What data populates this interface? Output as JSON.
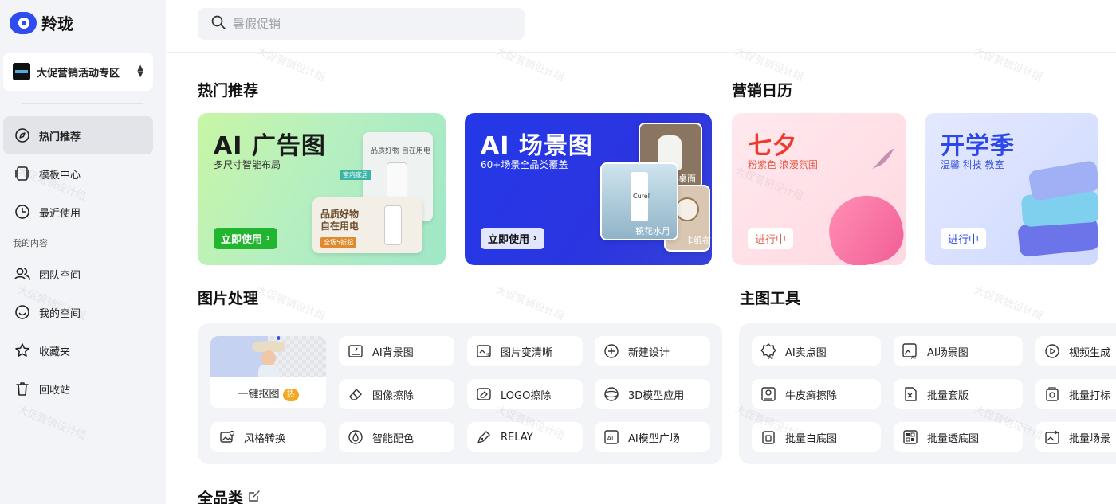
{
  "app": {
    "name": "羚珑"
  },
  "space": {
    "name": "大促营销活动专区"
  },
  "sidebar": {
    "items": [
      {
        "label": "热门推荐",
        "icon": "compass-icon"
      },
      {
        "label": "模板中心",
        "icon": "template-icon"
      },
      {
        "label": "最近使用",
        "icon": "clock-icon"
      }
    ],
    "my_section_label": "我的内容",
    "my_items": [
      {
        "label": "团队空间",
        "icon": "team-icon"
      },
      {
        "label": "我的空间",
        "icon": "smile-icon"
      },
      {
        "label": "收藏夹",
        "icon": "star-icon"
      },
      {
        "label": "回收站",
        "icon": "trash-icon"
      }
    ]
  },
  "search": {
    "placeholder": "暑假促销"
  },
  "sections": {
    "hot": "热门推荐",
    "calendar": "营销日历",
    "image_processing": "图片处理",
    "main_image_tools": "主图工具",
    "all_categories": "全品类"
  },
  "banners": {
    "ad": {
      "title": "AI 广告图",
      "subtitle": "多尺寸智能布局",
      "button": "立即使用",
      "card_text_1": "品质好物 自在用电",
      "card_tag": "室内家居",
      "card_text_2a": "品质好物",
      "card_text_2b": "自在用电",
      "card_ribbon": "全场5折起"
    },
    "scene": {
      "title": "AI 场景图",
      "subtitle": "60+场景全品类覆盖",
      "button": "立即使用",
      "tag_desk": "桌面",
      "tag_mirror": "镜花水月",
      "tag_card": "卡纸布",
      "brand": "Curél"
    },
    "qixi": {
      "title": "七夕",
      "subtitle": "粉紫色 浪漫氛围",
      "status": "进行中"
    },
    "school": {
      "title": "开学季",
      "subtitle": "温馨 科技 教室",
      "status": "进行中"
    }
  },
  "image_tools": {
    "cutout": {
      "label": "一键抠图",
      "badge": "热"
    },
    "items": [
      {
        "label": "AI背景图",
        "icon": "image-edit-icon"
      },
      {
        "label": "图片变清晰",
        "icon": "hd-image-icon"
      },
      {
        "label": "新建设计",
        "icon": "plus-circle-icon"
      },
      {
        "label": "图像擦除",
        "icon": "eraser-icon"
      },
      {
        "label": "LOGO擦除",
        "icon": "logo-erase-icon"
      },
      {
        "label": "3D模型应用",
        "icon": "cube-3d-icon"
      },
      {
        "label": "风格转换",
        "icon": "style-transfer-icon"
      },
      {
        "label": "智能配色",
        "icon": "palette-drop-icon"
      },
      {
        "label": "RELAY",
        "icon": "relay-pen-icon"
      },
      {
        "label": "AI模型广场",
        "icon": "ai-model-icon"
      }
    ]
  },
  "main_tools": {
    "items": [
      {
        "label": "AI卖点图",
        "icon": "ai-badge-icon"
      },
      {
        "label": "AI场景图",
        "icon": "ai-scene-icon"
      },
      {
        "label": "视频生成",
        "icon": "video-play-icon"
      },
      {
        "label": "牛皮癣擦除",
        "icon": "psoriasis-erase-icon"
      },
      {
        "label": "批量套版",
        "icon": "batch-template-icon"
      },
      {
        "label": "批量打标",
        "icon": "batch-tag-icon"
      },
      {
        "label": "批量白底图",
        "icon": "white-bg-icon"
      },
      {
        "label": "批量透底图",
        "icon": "transparent-bg-icon"
      },
      {
        "label": "批量场景",
        "icon": "batch-scene-icon"
      }
    ]
  },
  "watermark": "大促营销设计组",
  "colors": {
    "brand": "#2f4cf0",
    "green": "#22b52f",
    "scene_blue": "#2438e8",
    "qixi_red": "#ee3b2b",
    "hot_badge": "#f5a623"
  }
}
